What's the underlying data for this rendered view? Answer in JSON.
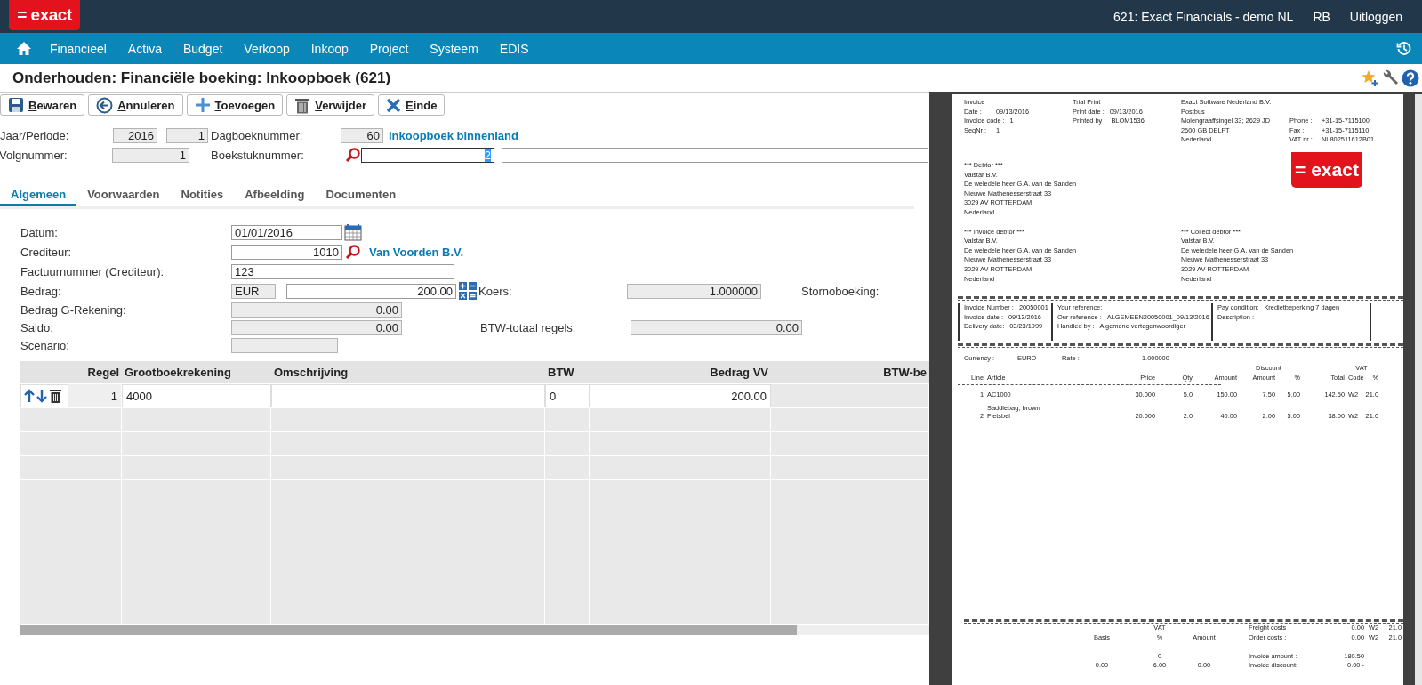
{
  "app": {
    "logo": "= exact",
    "company": "621: Exact Financials - demo NL",
    "user": "RB",
    "logout": "Uitloggen"
  },
  "nav": {
    "items": [
      "Financieel",
      "Activa",
      "Budget",
      "Verkoop",
      "Inkoop",
      "Project",
      "Systeem",
      "EDIS"
    ]
  },
  "page_title": "Onderhouden: Financiële boeking: Inkoopboek (621)",
  "toolbar": [
    {
      "label": "Bewaren",
      "kind": "save"
    },
    {
      "label": "Annuleren",
      "kind": "cancel"
    },
    {
      "label": "Toevoegen",
      "kind": "add"
    },
    {
      "label": "Verwijder",
      "kind": "delete"
    },
    {
      "label": "Einde",
      "kind": "close"
    }
  ],
  "header": {
    "jaar_periode": {
      "label": "Jaar/Periode:",
      "year": "2016",
      "period": "1"
    },
    "dagboek": {
      "label": "Dagboeknummer:",
      "value": "60",
      "link": "Inkoopboek binnenland"
    },
    "volgnummer": {
      "label": "Volgnummer:",
      "value": "1"
    },
    "boekstuk": {
      "label": "Boekstuknummer:",
      "value": "2"
    }
  },
  "tabs": [
    {
      "label": "Algemeen",
      "selected": true
    },
    {
      "label": "Voorwaarden",
      "selected": false
    },
    {
      "label": "Notities",
      "selected": false
    },
    {
      "label": "Afbeelding",
      "selected": false
    },
    {
      "label": "Documenten",
      "selected": false
    }
  ],
  "form": {
    "datum": {
      "label": "Datum:",
      "value": "01/01/2016"
    },
    "crediteur": {
      "label": "Crediteur:",
      "value": "1010",
      "link": "Van Voorden B.V."
    },
    "factuurnummer": {
      "label": "Factuurnummer (Crediteur):",
      "value": "123"
    },
    "bedrag": {
      "label": "Bedrag:",
      "currency": "EUR",
      "value": "200.00"
    },
    "koers": {
      "label": "Koers:",
      "value": "1.000000"
    },
    "storno": {
      "label": "Stornoboeking:"
    },
    "bedrag_g": {
      "label": "Bedrag G-Rekening:",
      "value": "0.00"
    },
    "saldo": {
      "label": "Saldo:",
      "value": "0.00"
    },
    "btw_totaal": {
      "label": "BTW-totaal regels:",
      "value": "0.00"
    },
    "scenario": {
      "label": "Scenario:"
    }
  },
  "lines": {
    "columns": [
      "Regel",
      "Grootboekrekening",
      "Omschrijving",
      "BTW",
      "Bedrag VV",
      "BTW-be"
    ],
    "rows": [
      {
        "regel": "1",
        "account": "4000",
        "btw": "0",
        "amount": "200.00"
      }
    ]
  },
  "invoice": {
    "meta_left": [
      {
        "label": "Invoice"
      },
      {
        "label": "Date :",
        "value": "09/13/2016"
      },
      {
        "label": "Invoice code :",
        "value": "1"
      },
      {
        "label": "SeqNr :",
        "value": "1"
      }
    ],
    "meta_mid": [
      {
        "label": "Trial Print"
      },
      {
        "label": "Print date :",
        "value": "09/13/2016"
      },
      {
        "label": "Printed by :",
        "value": "BLOM1536"
      }
    ],
    "company": [
      "Exact Software Nederland B.V.",
      "Postbus",
      "Molengraaffsingel 33; 2629 JD",
      "2600 GB DELFT",
      "Nederland"
    ],
    "contact": [
      {
        "label": "Phone :",
        "value": "+31-15-7115100"
      },
      {
        "label": "Fax :",
        "value": "+31-15-7115110"
      },
      {
        "label": "VAT nr :",
        "value": "NL802511612B01"
      }
    ],
    "logo": "= exact",
    "debtor": {
      "title": "***  Debtor  ***",
      "lines": [
        "Valstar B.V.",
        "De weledele heer G.A. van de Sanden",
        "Nieuwe Mathenesserstraat 33",
        "3029 AV  ROTTERDAM",
        "Nederland"
      ]
    },
    "invoice_debtor": {
      "title": "***  Invoice debtor  ***",
      "lines": [
        "Valstar B.V.",
        "De weledele heer G.A. van de Sanden",
        "Nieuwe Mathenesserstraat 33",
        "3029 AV  ROTTERDAM",
        "Nederland"
      ]
    },
    "collect_debtor": {
      "title": "***  Collect debtor  ***",
      "lines": [
        "Valstar B.V.",
        "De weledele heer G.A. van de Sanden",
        "Nieuwe Mathenesserstraat 33",
        "3029 AV ROTTERDAM",
        "Nederland"
      ]
    },
    "references": [
      [
        {
          "label": "Invoice Number :",
          "value": "20050001"
        },
        {
          "label": "Invoice date :",
          "value": "09/13/2016"
        },
        {
          "label": "Delivery date:",
          "value": "03/23/1999"
        }
      ],
      [
        {
          "label": "Your reference:"
        },
        {
          "label": "Our reference :",
          "value": "ALGEMEEN20050001_09/13/2016"
        },
        {
          "label": "Handled by :",
          "value": "Algemene vertegenwoordiger"
        }
      ],
      [
        {
          "label": "Pay condition:",
          "value": "Kredietbeperking 7 dagen"
        },
        {
          "label": "Description :"
        }
      ]
    ],
    "currency": {
      "label": "Currency :",
      "value": "EURO"
    },
    "rate": {
      "label": "Rate :",
      "value": "1.000000"
    },
    "line_groups": {
      "discount": "Discount",
      "vat": "VAT"
    },
    "line_columns": [
      "Line",
      "Article",
      "Price",
      "Qty",
      "Amount",
      "Amount",
      "%",
      "Total",
      "Code",
      "%"
    ],
    "line_rows": [
      {
        "cells": [
          "1",
          "AC1000",
          "30.000",
          "5.0",
          "150.00",
          "7.50",
          "5.00",
          "142.50",
          "W2",
          "21.0"
        ]
      },
      {
        "description": "Saddlebag, brown",
        "cells": [
          "2",
          "Fietsbel",
          "20.000",
          "2.0",
          "40.00",
          "2.00",
          "5.00",
          "38.00",
          "W2",
          "21.0"
        ]
      }
    ],
    "vat_table": {
      "group": "VAT",
      "columns": [
        "Basis",
        "%",
        "Amount"
      ],
      "rows": [
        {
          "pct": "0"
        },
        {
          "basis": "0.00",
          "pct": "6.00",
          "amount": "0.00"
        }
      ]
    },
    "costs": [
      {
        "label": "Freight costs :",
        "value": "0.00",
        "code": "W2",
        "pct": "21.0"
      },
      {
        "label": "Order costs :",
        "value": "0.00",
        "code": "W2",
        "pct": "21.0"
      }
    ],
    "totals": [
      {
        "label": "Invoice amount :",
        "value": "180.50"
      },
      {
        "label": "Invoice discount:",
        "value": "0.00 -"
      }
    ]
  }
}
